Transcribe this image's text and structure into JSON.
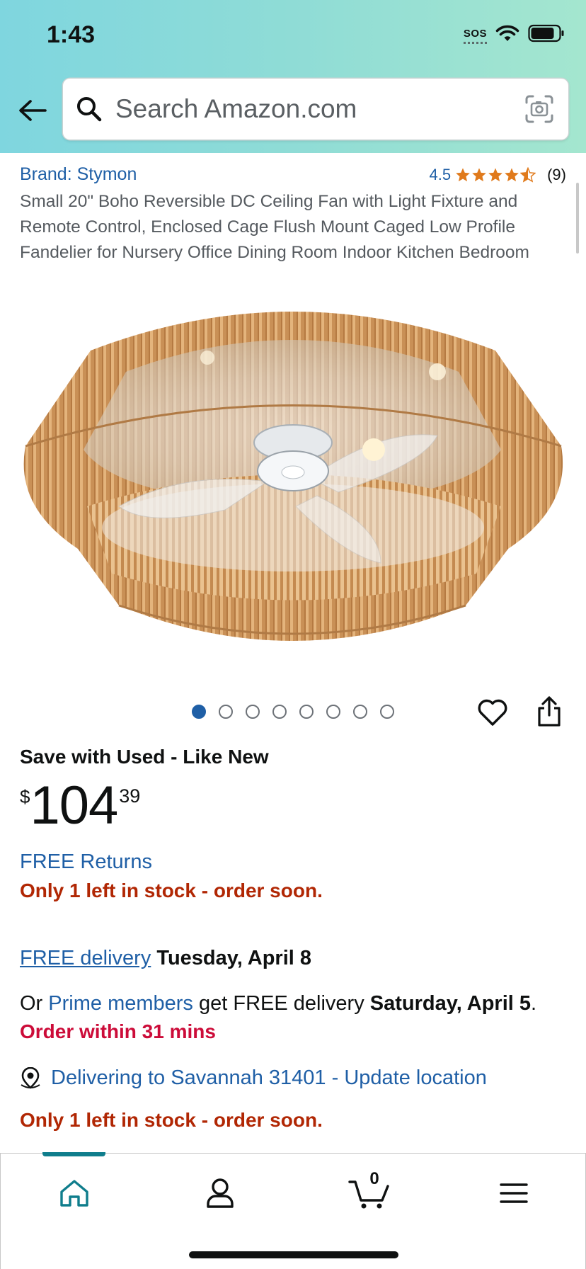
{
  "status_bar": {
    "time": "1:43",
    "sos": "SOS"
  },
  "search": {
    "placeholder": "Search Amazon.com"
  },
  "product": {
    "brand": "Brand: Stymon",
    "rating_value": "4.5",
    "rating_count": "(9)",
    "rating_stars": 4.5,
    "title": "Small 20\" Boho Reversible DC Ceiling Fan with Light Fixture and Remote Control, Enclosed Cage Flush Mount Caged Low Profile Fandelier for Nursery Office Dining Room Indoor Kitchen Bedroom",
    "image_count": 8,
    "active_image": 1
  },
  "offer": {
    "save_label": "Save with Used - Like New",
    "price_symbol": "$",
    "price_whole": "104",
    "price_fraction": "39",
    "free_returns": "FREE Returns",
    "stock_notice": "Only 1 left in stock - order soon.",
    "free_delivery_link": "FREE delivery",
    "delivery_date": " Tuesday, April 8",
    "prime_prefix": "Or ",
    "prime_link": "Prime members",
    "prime_mid": " get FREE delivery ",
    "prime_date": "Saturday, April 5",
    "prime_suffix": ".",
    "order_within": "Order within 31 mins",
    "location": "Delivering to Savannah 31401 - Update location"
  },
  "nav": {
    "cart_count": "0"
  },
  "colors": {
    "link": "#1f5fa6",
    "stock_red": "#b12704",
    "urgent_red": "#cc0c39",
    "star": "#e07a1c",
    "nav_teal": "#0f7d8c"
  }
}
